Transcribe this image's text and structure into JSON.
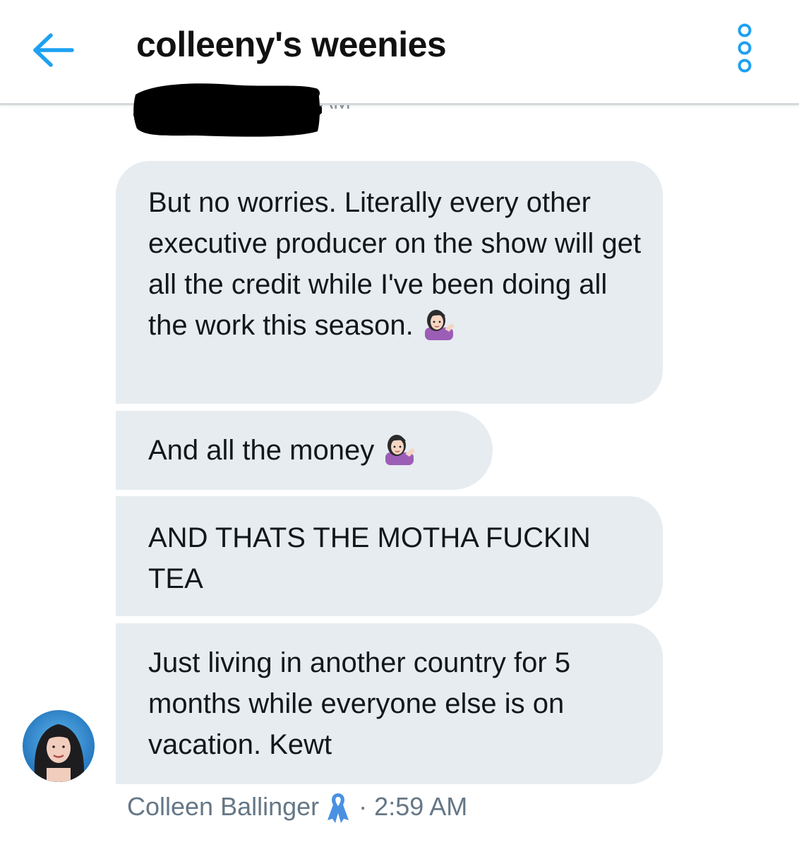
{
  "header": {
    "title": "colleeny's weenies",
    "back_icon": "arrow-left-icon",
    "more_icon": "more-options-icon",
    "accent_color": "#1da1f2"
  },
  "previous_timestamp": "AM",
  "messages": [
    {
      "text": "But no worries. Literally every other executive producer on the show will get all the credit while I've been doing all the work this season.",
      "emoji": "woman-tipping-hand-emoji"
    },
    {
      "text": "And all the money",
      "emoji": "woman-tipping-hand-emoji"
    },
    {
      "text": "AND THATS THE MOTHA FUCKIN TEA"
    },
    {
      "text": "Just living in another country for 5 months while everyone else is on vacation. Kewt"
    }
  ],
  "footer": {
    "sender_name": "Colleen Ballinger",
    "badge_icon": "awareness-ribbon-icon",
    "separator": "·",
    "time": "2:59 AM"
  },
  "colors": {
    "bubble_bg": "#e6ecf0",
    "text": "#14171a",
    "meta_text": "#657786",
    "ribbon": "#4a90e2"
  }
}
